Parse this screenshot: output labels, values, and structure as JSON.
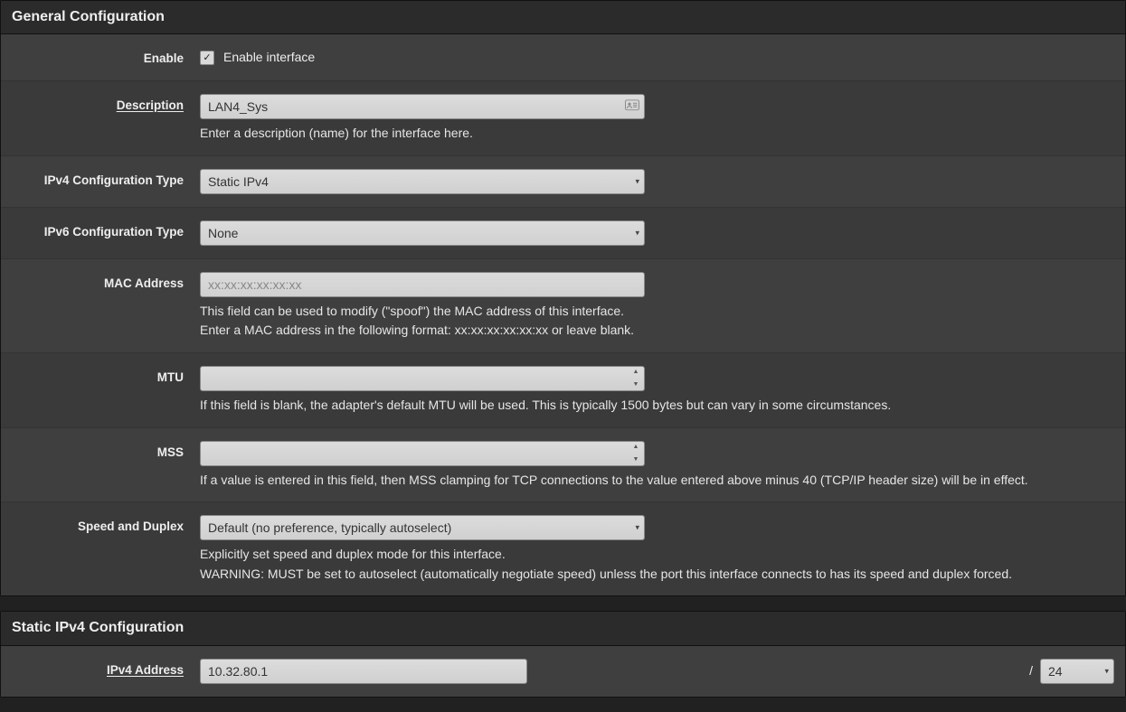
{
  "general": {
    "header": "General Configuration",
    "enable": {
      "label": "Enable",
      "checked": true,
      "text": "Enable interface"
    },
    "description": {
      "label": "Description",
      "value": "LAN4_Sys",
      "help": "Enter a description (name) for the interface here."
    },
    "ipv4type": {
      "label": "IPv4 Configuration Type",
      "value": "Static IPv4"
    },
    "ipv6type": {
      "label": "IPv6 Configuration Type",
      "value": "None"
    },
    "mac": {
      "label": "MAC Address",
      "placeholder": "xx:xx:xx:xx:xx:xx",
      "value": "",
      "help1": "This field can be used to modify (\"spoof\") the MAC address of this interface.",
      "help2": "Enter a MAC address in the following format: xx:xx:xx:xx:xx:xx or leave blank."
    },
    "mtu": {
      "label": "MTU",
      "value": "",
      "help": "If this field is blank, the adapter's default MTU will be used. This is typically 1500 bytes but can vary in some circumstances."
    },
    "mss": {
      "label": "MSS",
      "value": "",
      "help": "If a value is entered in this field, then MSS clamping for TCP connections to the value entered above minus 40 (TCP/IP header size) will be in effect."
    },
    "speed": {
      "label": "Speed and Duplex",
      "value": "Default (no preference, typically autoselect)",
      "help1": "Explicitly set speed and duplex mode for this interface.",
      "help2": "WARNING: MUST be set to autoselect (automatically negotiate speed) unless the port this interface connects to has its speed and duplex forced."
    }
  },
  "staticv4": {
    "header": "Static IPv4 Configuration",
    "addr": {
      "label": "IPv4 Address",
      "value": "10.32.80.1",
      "slash": "/",
      "cidr": "24"
    }
  }
}
